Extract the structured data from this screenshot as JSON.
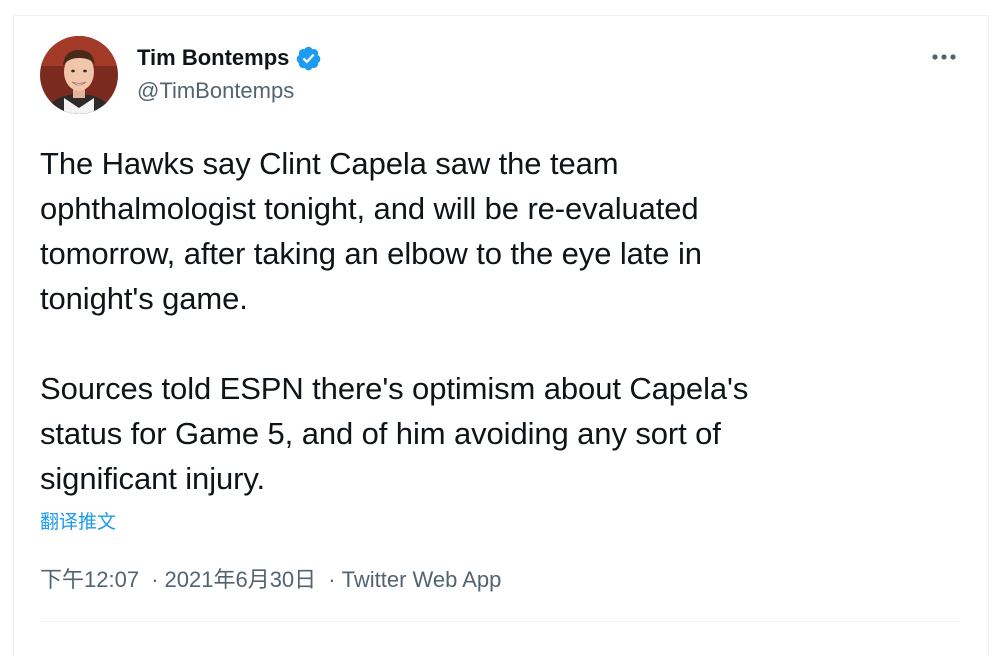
{
  "tweet": {
    "author": {
      "display_name": "Tim Bontemps",
      "handle": "@TimBontemps",
      "verified_icon": "verified-badge-icon",
      "avatar_icon": "avatar"
    },
    "paragraph_1": "The Hawks say Clint Capela saw the team\nophthalmologist tonight, and will be re-evaluated\ntomorrow, after taking an elbow to the eye late in\ntonight's game.",
    "paragraph_2": "Sources told ESPN there's optimism about Capela's\nstatus for Game 5, and of him avoiding any sort of\nsignificant injury.",
    "translate_label": "翻译推文",
    "time": "下午12:07",
    "separator": "·",
    "date": "2021年6月30日",
    "source": "Twitter Web App",
    "more_icon": "more-horizontal-icon"
  },
  "colors": {
    "text": "#0f1419",
    "secondary": "#536471",
    "link": "#1d9bf0",
    "verified": "#1d9bf0",
    "border": "#eff3f4"
  }
}
